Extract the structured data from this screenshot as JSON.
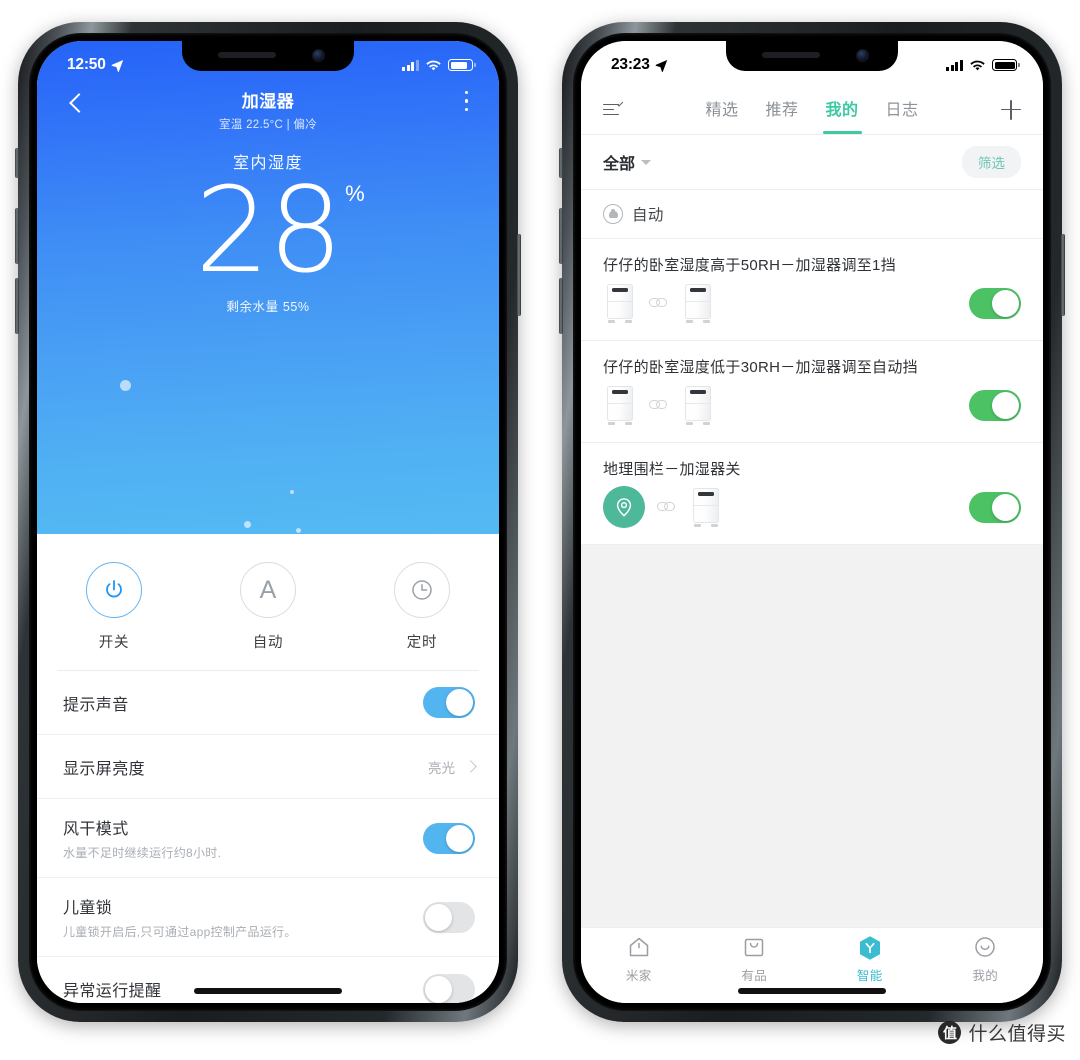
{
  "left_phone": {
    "status_bar": {
      "time": "12:50",
      "location_icon": "location-arrow-icon",
      "signal_icon": "cellular-signal-icon",
      "wifi_icon": "wifi-icon",
      "battery_icon": "battery-icon"
    },
    "navbar": {
      "back_icon": "back-chevron-icon",
      "title": "加湿器",
      "subtitle": "室温 22.5°C | 偏冷",
      "more_icon": "more-vertical-icon"
    },
    "hero": {
      "label": "室内湿度",
      "value": "28",
      "unit": "%",
      "water_level": "剩余水量 55%",
      "gradient_from": "#2563f7",
      "gradient_to": "#54baf3"
    },
    "controls": [
      {
        "label": "开关",
        "icon": "power-icon",
        "active": true
      },
      {
        "label": "自动",
        "icon": "auto-a-icon",
        "active": false
      },
      {
        "label": "定时",
        "icon": "clock-icon",
        "active": false
      }
    ],
    "settings": [
      {
        "title": "提示声音",
        "subtitle": "",
        "type": "toggle",
        "state": "on"
      },
      {
        "title": "显示屏亮度",
        "subtitle": "",
        "type": "value",
        "value": "亮光",
        "chevron_icon": "chevron-right-icon"
      },
      {
        "title": "风干模式",
        "subtitle": "水量不足时继续运行约8小时.",
        "type": "toggle",
        "state": "on"
      },
      {
        "title": "儿童锁",
        "subtitle": "儿童锁开启后,只可通过app控制产品运行。",
        "type": "toggle",
        "state": "off"
      },
      {
        "title": "异常运行提醒",
        "subtitle": "",
        "type": "toggle",
        "state": "off"
      }
    ],
    "toggle_on_color": "#53b5f0",
    "toggle_off_color": "#e2e4e6"
  },
  "right_phone": {
    "status_bar": {
      "time": "23:23",
      "location_icon": "location-arrow-icon",
      "signal_icon": "cellular-signal-icon",
      "wifi_icon": "wifi-icon",
      "battery_icon": "battery-icon"
    },
    "top_bar": {
      "menu_icon": "list-check-icon",
      "add_icon": "plus-icon",
      "tabs": [
        {
          "label": "精选",
          "active": false
        },
        {
          "label": "推荐",
          "active": false
        },
        {
          "label": "我的",
          "active": true
        },
        {
          "label": "日志",
          "active": false
        }
      ],
      "accent_color": "#3ec8a4"
    },
    "filter_bar": {
      "all_label": "全部",
      "caret_icon": "caret-down-icon",
      "filter_label": "筛选"
    },
    "section": {
      "icon": "robot-head-icon",
      "title": "自动"
    },
    "automations": [
      {
        "title": "仔仔的卧室湿度高于50RH－加湿器调至1挡",
        "source_icon": "humidifier-icon",
        "link_icon": "link-icon",
        "target_icon": "humidifier-icon",
        "state": "on"
      },
      {
        "title": "仔仔的卧室湿度低于30RH－加湿器调至自动挡",
        "source_icon": "humidifier-icon",
        "link_icon": "link-icon",
        "target_icon": "humidifier-icon",
        "state": "on"
      },
      {
        "title": "地理围栏－加湿器关",
        "source_icon": "geofence-location-icon",
        "link_icon": "link-icon",
        "target_icon": "humidifier-icon",
        "state": "on"
      }
    ],
    "toggle_on_color": "#4cc264",
    "tabbar": [
      {
        "label": "米家",
        "icon": "home-icon",
        "active": false
      },
      {
        "label": "有品",
        "icon": "shopping-bag-icon",
        "active": false
      },
      {
        "label": "智能",
        "icon": "smart-hexagon-icon",
        "active": true
      },
      {
        "label": "我的",
        "icon": "smiley-face-icon",
        "active": false
      }
    ],
    "tabbar_accent": "#3bbcd0"
  },
  "watermark": {
    "logo_char": "值",
    "text": "什么值得买"
  }
}
